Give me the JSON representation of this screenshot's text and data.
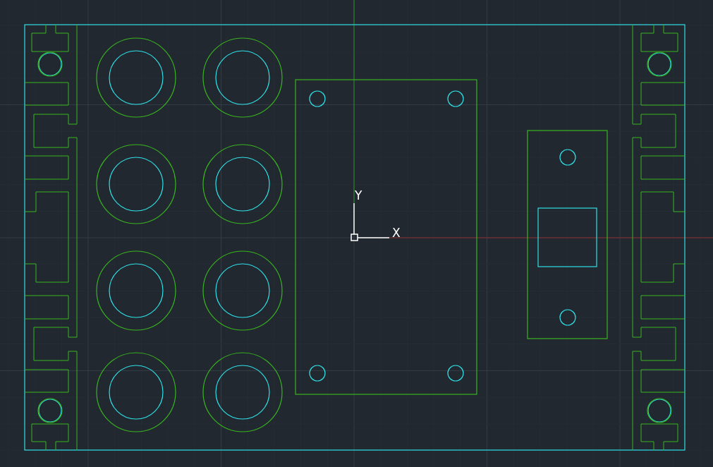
{
  "viewport": {
    "ucs_icon": {
      "y_label": "Y",
      "x_label": "X"
    }
  }
}
